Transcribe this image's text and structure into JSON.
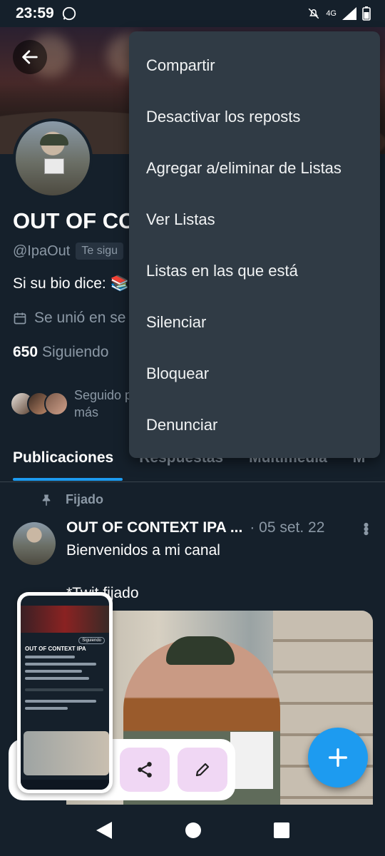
{
  "status_bar": {
    "time": "23:59",
    "network": "4G"
  },
  "profile": {
    "name": "OUT OF CO",
    "handle": "@IpaOut",
    "follows_you": "Te sigu",
    "bio": "Si su bio dice: 📚",
    "joined": "Se unió en se",
    "following_count": "650",
    "following_label": "Siguiendo",
    "followed_by_line1": "Seguido p",
    "followed_by_line2": "más"
  },
  "tabs": [
    "Publicaciones",
    "Respuestas",
    "Multimedia",
    "M"
  ],
  "tweet": {
    "pinned_label": "Fijado",
    "author": "OUT OF CONTEXT IPA ...",
    "date": "· 05 set. 22",
    "text": "Bienvenidos a mi canal",
    "text2": "*Twit fijado"
  },
  "menu": {
    "items": [
      "Compartir",
      "Desactivar los reposts",
      "Agregar a/eliminar de Listas",
      "Ver Listas",
      "Listas en las que está",
      "Silenciar",
      "Bloquear",
      "Denunciar"
    ]
  },
  "thumbnail": {
    "title": "OUT OF CONTEXT IPA",
    "follow_button": "Siguiendo"
  },
  "colors": {
    "background": "#15202b",
    "accent": "#1d9bf0",
    "menu_bg": "#303b45",
    "secondary_text": "#8b98a5"
  },
  "icons": [
    "back-arrow-icon",
    "pin-icon",
    "calendar-icon",
    "share-icon",
    "edit-icon",
    "plus-icon",
    "more-vertical-icon"
  ]
}
